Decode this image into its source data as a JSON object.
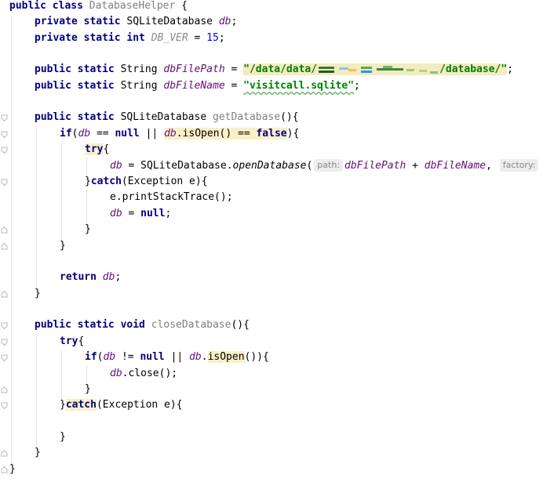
{
  "editor": {
    "language": "java",
    "lines": {
      "l1": {
        "kw": "public class ",
        "name": "DatabaseHelper",
        "rest": " {"
      },
      "l2": {
        "kw": "private static ",
        "type": "SQLiteDatabase ",
        "name": "db",
        "rest": ";"
      },
      "l3": {
        "kw": "private static int ",
        "name": "DB_VER",
        "eq": " = ",
        "num": "15",
        "rest": ";"
      },
      "l4": {
        "kw": "public static ",
        "type": "String ",
        "name": "dbFilePath",
        "eq": " = ",
        "str_a": "\"/data/data/",
        "str_b": "/database/\"",
        "rest": ";"
      },
      "l5": {
        "kw": "public static ",
        "type": "String ",
        "name": "dbFileName",
        "eq": " = ",
        "str": "\"visitcall.sqlite\"",
        "rest": ";"
      },
      "l6": {
        "kw": "public static ",
        "type": "SQLiteDatabase ",
        "name": "getDatabase",
        "rest": "(){"
      },
      "l7": {
        "kw": "if",
        "p1": "(",
        "db1": "db",
        "op": " == ",
        "null": "null",
        "or": " || ",
        "db2": "db",
        "call": ".isOpen() == ",
        "false": "false",
        "rest": "){"
      },
      "l8": {
        "kw": "try",
        "rest": "{"
      },
      "l9": {
        "db": "db",
        "eq": " = SQLiteDatabase.",
        "method": "openDatabase",
        "p": "(",
        "hint1": "path:",
        "a1": "dbFilePath",
        "plus": " + ",
        "a2": "dbFileName",
        "comma": ",",
        "hint2": "factory:"
      },
      "l10": {
        "pre": "}",
        "kw": "catch",
        "rest": "(Exception e){"
      },
      "l11": {
        "text": "e.printStackTrace();"
      },
      "l12": {
        "db": "db",
        "eq": " = ",
        "null": "null",
        "rest": ";"
      },
      "l13": {
        "text": "}"
      },
      "l14": {
        "text": "}"
      },
      "l15": {
        "kw": "return ",
        "db": "db",
        "rest": ";"
      },
      "l16": {
        "text": "}"
      },
      "l17": {
        "kw": "public static void ",
        "name": "closeDatabase",
        "rest": "(){"
      },
      "l18": {
        "kw": "try",
        "rest": "{"
      },
      "l19": {
        "kw": "if",
        "p1": "(",
        "db1": "db",
        "op": " != ",
        "null": "null",
        "or": " || ",
        "db2": "db",
        "dot": ".",
        "call": "isOpen",
        "rest": "()){"
      },
      "l20": {
        "db": "db",
        "rest": ".close();"
      },
      "l21": {
        "text": "}"
      },
      "l22": {
        "pre": "}",
        "kw": "catch",
        "rest": "(Exception e){"
      },
      "l23": {
        "text": "}"
      },
      "l24": {
        "text": "}"
      },
      "l25": {
        "text": "}"
      }
    }
  }
}
